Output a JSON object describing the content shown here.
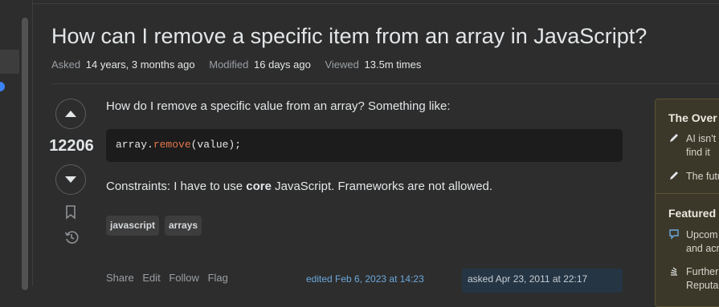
{
  "question": {
    "title": "How can I remove a specific item from an array in JavaScript?",
    "meta": {
      "asked_label": "Asked",
      "asked_value": "14 years, 3 months ago",
      "modified_label": "Modified",
      "modified_value": "16 days ago",
      "viewed_label": "Viewed",
      "viewed_value": "13.5m times"
    },
    "votes": "12206",
    "body": {
      "line1": "How do I remove a specific value from an array? Something like:",
      "code_prefix": "array.",
      "code_fn": "remove",
      "code_suffix": "(value);",
      "constraints_prefix": "Constraints: I have to use ",
      "constraints_bold": "core",
      "constraints_suffix": " JavaScript. Frameworks are not allowed."
    },
    "tags": [
      "javascript",
      "arrays"
    ],
    "menu": [
      "Share",
      "Edit",
      "Follow",
      "Flag"
    ],
    "edited": "edited Feb 6, 2023 at 14:23",
    "asked_card": "asked Apr 23, 2011 at 22:17"
  },
  "sidebar": {
    "section1_title": "The Over",
    "item1": "AI isn't",
    "item1_line2": "find it",
    "item2": "The futu",
    "section2_title": "Featured",
    "item3": "Upcom",
    "item3_line2": "and acr",
    "item4": "Further",
    "item4_line2": "Reputa"
  },
  "icons": {
    "up": "caret-up-icon",
    "down": "caret-down-icon",
    "bookmark": "bookmark-icon",
    "history": "history-icon",
    "pencil": "pencil-icon",
    "comment": "comment-icon",
    "stack": "stack-exchange-icon"
  },
  "colors": {
    "background": "#2d2d2d",
    "code_fn": "#e5764b",
    "link": "#6ca8dc",
    "sidebar_bg": "#3b382a"
  }
}
